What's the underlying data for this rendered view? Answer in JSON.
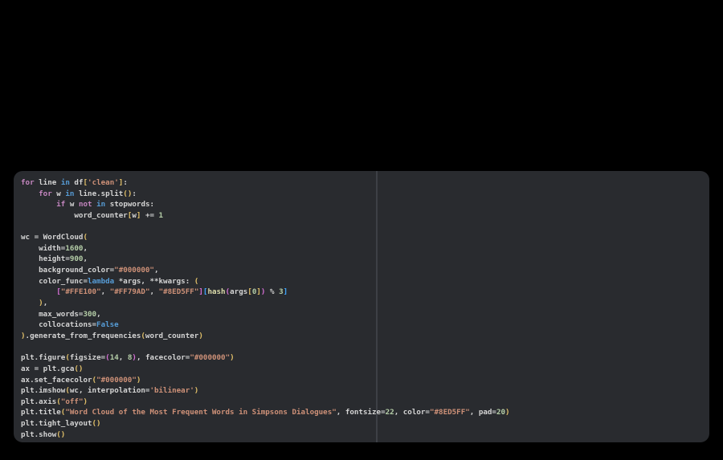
{
  "app": {
    "kind": "dark-code-editor-snippet",
    "language": "python",
    "background_color": "#000000",
    "panel_color": "#292b2f",
    "ruler_column": 80,
    "ruler_color": "#3d4046"
  },
  "palette": {
    "def": "#d4d4d4",
    "kw": "#c586c0",
    "kw2": "#569cd6",
    "str": "#ce9178",
    "num": "#b5cea8",
    "fn": "#dcdcaa",
    "b1": "#e2c069",
    "b2": "#d670d6",
    "b3": "#3fa7ff"
  },
  "code": {
    "lines": [
      [
        [
          "kw",
          "for"
        ],
        [
          "def",
          " line "
        ],
        [
          "kw2",
          "in"
        ],
        [
          "def",
          " df"
        ],
        [
          "b1",
          "["
        ],
        [
          "str",
          "'clean'"
        ],
        [
          "b1",
          "]"
        ],
        [
          "def",
          ":"
        ]
      ],
      [
        [
          "def",
          "    "
        ],
        [
          "kw",
          "for"
        ],
        [
          "def",
          " w "
        ],
        [
          "kw2",
          "in"
        ],
        [
          "def",
          " line.split"
        ],
        [
          "b1",
          "()"
        ],
        [
          "def",
          ":"
        ]
      ],
      [
        [
          "def",
          "        "
        ],
        [
          "kw",
          "if"
        ],
        [
          "def",
          " w "
        ],
        [
          "kw",
          "not"
        ],
        [
          "def",
          " "
        ],
        [
          "kw2",
          "in"
        ],
        [
          "def",
          " stopwords:"
        ]
      ],
      [
        [
          "def",
          "            word_counter"
        ],
        [
          "b1",
          "["
        ],
        [
          "def",
          "w"
        ],
        [
          "b1",
          "]"
        ],
        [
          "def",
          " += "
        ],
        [
          "num",
          "1"
        ]
      ],
      [],
      [
        [
          "def",
          "wc = WordCloud"
        ],
        [
          "b1",
          "("
        ]
      ],
      [
        [
          "def",
          "    width="
        ],
        [
          "num",
          "1600"
        ],
        [
          "def",
          ","
        ]
      ],
      [
        [
          "def",
          "    height="
        ],
        [
          "num",
          "900"
        ],
        [
          "def",
          ","
        ]
      ],
      [
        [
          "def",
          "    background_color="
        ],
        [
          "str",
          "\"#000000\""
        ],
        [
          "def",
          ","
        ]
      ],
      [
        [
          "def",
          "    color_func="
        ],
        [
          "kw2",
          "lambda"
        ],
        [
          "def",
          " *args, **kwargs: "
        ],
        [
          "b1",
          "("
        ]
      ],
      [
        [
          "def",
          "        "
        ],
        [
          "b2",
          "["
        ],
        [
          "str",
          "\"#FFE100\""
        ],
        [
          "def",
          ", "
        ],
        [
          "str",
          "\"#FF79AD\""
        ],
        [
          "def",
          ", "
        ],
        [
          "str",
          "\"#8ED5FF\""
        ],
        [
          "b2",
          "]"
        ],
        [
          "b3",
          "["
        ],
        [
          "fn",
          "hash"
        ],
        [
          "b2",
          "("
        ],
        [
          "def",
          "args"
        ],
        [
          "b1",
          "["
        ],
        [
          "num",
          "0"
        ],
        [
          "b1",
          "]"
        ],
        [
          "b2",
          ")"
        ],
        [
          "def",
          " % "
        ],
        [
          "num",
          "3"
        ],
        [
          "b3",
          "]"
        ]
      ],
      [
        [
          "def",
          "    "
        ],
        [
          "b1",
          ")"
        ],
        [
          "def",
          ","
        ]
      ],
      [
        [
          "def",
          "    max_words="
        ],
        [
          "num",
          "300"
        ],
        [
          "def",
          ","
        ]
      ],
      [
        [
          "def",
          "    collocations="
        ],
        [
          "kw2",
          "False"
        ]
      ],
      [
        [
          "b1",
          ")"
        ],
        [
          "def",
          ".generate_from_frequencies"
        ],
        [
          "b1",
          "("
        ],
        [
          "def",
          "word_counter"
        ],
        [
          "b1",
          ")"
        ]
      ],
      [],
      [
        [
          "def",
          "plt.figure"
        ],
        [
          "b1",
          "("
        ],
        [
          "def",
          "figsize="
        ],
        [
          "b2",
          "("
        ],
        [
          "num",
          "14"
        ],
        [
          "def",
          ", "
        ],
        [
          "num",
          "8"
        ],
        [
          "b2",
          ")"
        ],
        [
          "def",
          ", facecolor="
        ],
        [
          "str",
          "\"#000000\""
        ],
        [
          "b1",
          ")"
        ]
      ],
      [
        [
          "def",
          "ax = plt.gca"
        ],
        [
          "b1",
          "()"
        ]
      ],
      [
        [
          "def",
          "ax.set_facecolor"
        ],
        [
          "b1",
          "("
        ],
        [
          "str",
          "\"#000000\""
        ],
        [
          "b1",
          ")"
        ]
      ],
      [
        [
          "def",
          "plt.imshow"
        ],
        [
          "b1",
          "("
        ],
        [
          "def",
          "wc, interpolation="
        ],
        [
          "str",
          "'bilinear'"
        ],
        [
          "b1",
          ")"
        ]
      ],
      [
        [
          "def",
          "plt.axis"
        ],
        [
          "b1",
          "("
        ],
        [
          "str",
          "\"off\""
        ],
        [
          "b1",
          ")"
        ]
      ],
      [
        [
          "def",
          "plt.title"
        ],
        [
          "b1",
          "("
        ],
        [
          "str",
          "\"Word Cloud of the Most Frequent Words in Simpsons Dialogues\""
        ],
        [
          "def",
          ", fontsize="
        ],
        [
          "num",
          "22"
        ],
        [
          "def",
          ", color="
        ],
        [
          "str",
          "\"#8ED5FF\""
        ],
        [
          "def",
          ", pad="
        ],
        [
          "num",
          "20"
        ],
        [
          "b1",
          ")"
        ]
      ],
      [
        [
          "def",
          "plt.tight_layout"
        ],
        [
          "b1",
          "()"
        ]
      ],
      [
        [
          "def",
          "plt.show"
        ],
        [
          "b1",
          "()"
        ]
      ]
    ]
  }
}
